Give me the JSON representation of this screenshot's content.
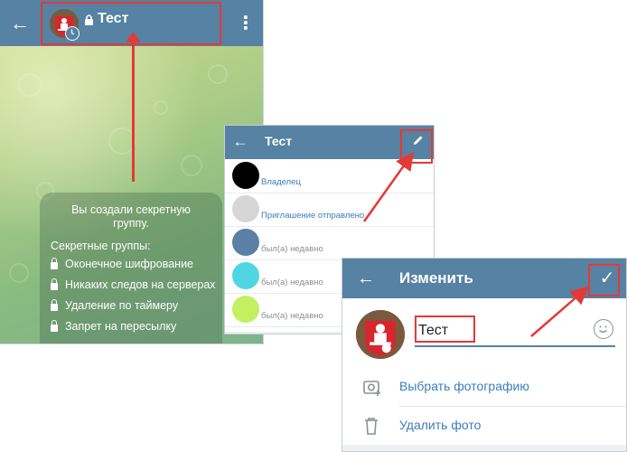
{
  "chat": {
    "title": "Тест",
    "info": {
      "title_line1": "Вы создали секретную",
      "title_line2": "группу.",
      "subtitle": "Секретные группы:",
      "items": [
        "Оконечное шифрование",
        "Никаких следов на серверах",
        "Удаление по таймеру",
        "Запрет на пересылку"
      ]
    }
  },
  "members": {
    "title": "Тест",
    "rows": [
      {
        "status": "Владелец",
        "avatar_color": "#000000",
        "status_color": "#3a7dbd"
      },
      {
        "status": "Приглашение отправлено",
        "avatar_color": "#d6d6d6",
        "status_color": "#3a7dbd"
      },
      {
        "status": "был(а) недавно",
        "avatar_color": "#5a80a6",
        "status_color": "#8a8f94"
      },
      {
        "status": "был(а) недавно",
        "avatar_color": "#4fd6e2",
        "status_color": "#8a8f94"
      },
      {
        "status": "был(а) недавно",
        "avatar_color": "#c2f060",
        "status_color": "#8a8f94"
      }
    ]
  },
  "edit": {
    "title": "Изменить",
    "name_value": "Тест",
    "actions": {
      "choose_photo": "Выбрать фотографию",
      "delete_photo": "Удалить фото"
    }
  },
  "colors": {
    "header": "#5682a3",
    "accent_blue": "#3a7dbd",
    "annotation_red": "#e53935"
  }
}
